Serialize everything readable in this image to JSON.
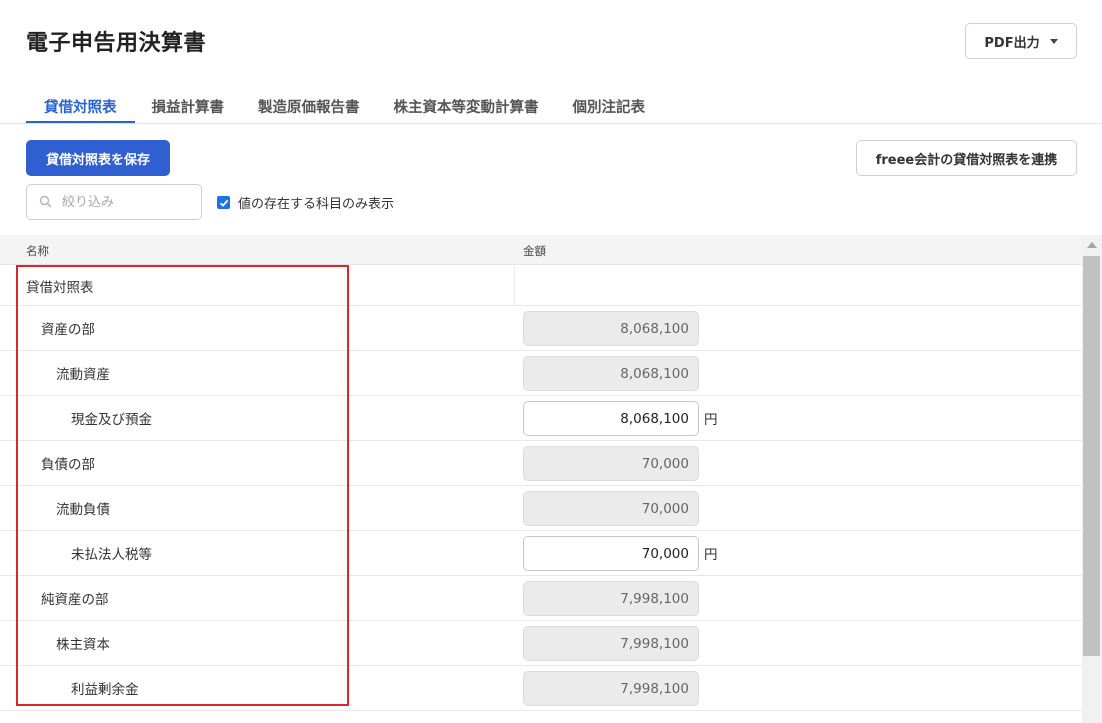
{
  "header": {
    "title": "電子申告用決算書",
    "pdf_button": "PDF出力"
  },
  "tabs": [
    {
      "label": "貸借対照表",
      "active": true
    },
    {
      "label": "損益計算書",
      "active": false
    },
    {
      "label": "製造原価報告書",
      "active": false
    },
    {
      "label": "株主資本等変動計算書",
      "active": false
    },
    {
      "label": "個別注記表",
      "active": false
    }
  ],
  "toolbar": {
    "save_button": "貸借対照表を保存",
    "link_button": "freee会計の貸借対照表を連携",
    "filter_placeholder": "絞り込み",
    "filter_value": "",
    "checkbox_label": "値の存在する科目のみ表示",
    "checkbox_checked": true
  },
  "table": {
    "headers": {
      "name": "名称",
      "amount": "金額"
    },
    "rows": [
      {
        "name": "貸借対照表",
        "level": 0,
        "amount": null,
        "editable": false,
        "unit": ""
      },
      {
        "name": "資産の部",
        "level": 1,
        "amount": "8,068,100",
        "editable": false,
        "unit": ""
      },
      {
        "name": "流動資産",
        "level": 2,
        "amount": "8,068,100",
        "editable": false,
        "unit": ""
      },
      {
        "name": "現金及び預金",
        "level": 3,
        "amount": "8,068,100",
        "editable": true,
        "unit": "円"
      },
      {
        "name": "負債の部",
        "level": 1,
        "amount": "70,000",
        "editable": false,
        "unit": ""
      },
      {
        "name": "流動負債",
        "level": 2,
        "amount": "70,000",
        "editable": false,
        "unit": ""
      },
      {
        "name": "未払法人税等",
        "level": 3,
        "amount": "70,000",
        "editable": true,
        "unit": "円"
      },
      {
        "name": "純資産の部",
        "level": 1,
        "amount": "7,998,100",
        "editable": false,
        "unit": ""
      },
      {
        "name": "株主資本",
        "level": 2,
        "amount": "7,998,100",
        "editable": false,
        "unit": ""
      },
      {
        "name": "利益剰余金",
        "level": 3,
        "amount": "7,998,100",
        "editable": false,
        "unit": ""
      }
    ]
  },
  "colors": {
    "accent": "#2864d2",
    "primary_button": "#2f5fd0",
    "highlight": "#d9262f",
    "checkbox": "#1a73e8"
  },
  "icons": {
    "pdf_dropdown": "caret-down-icon",
    "filter": "search-icon",
    "checkbox": "checkmark-icon"
  }
}
